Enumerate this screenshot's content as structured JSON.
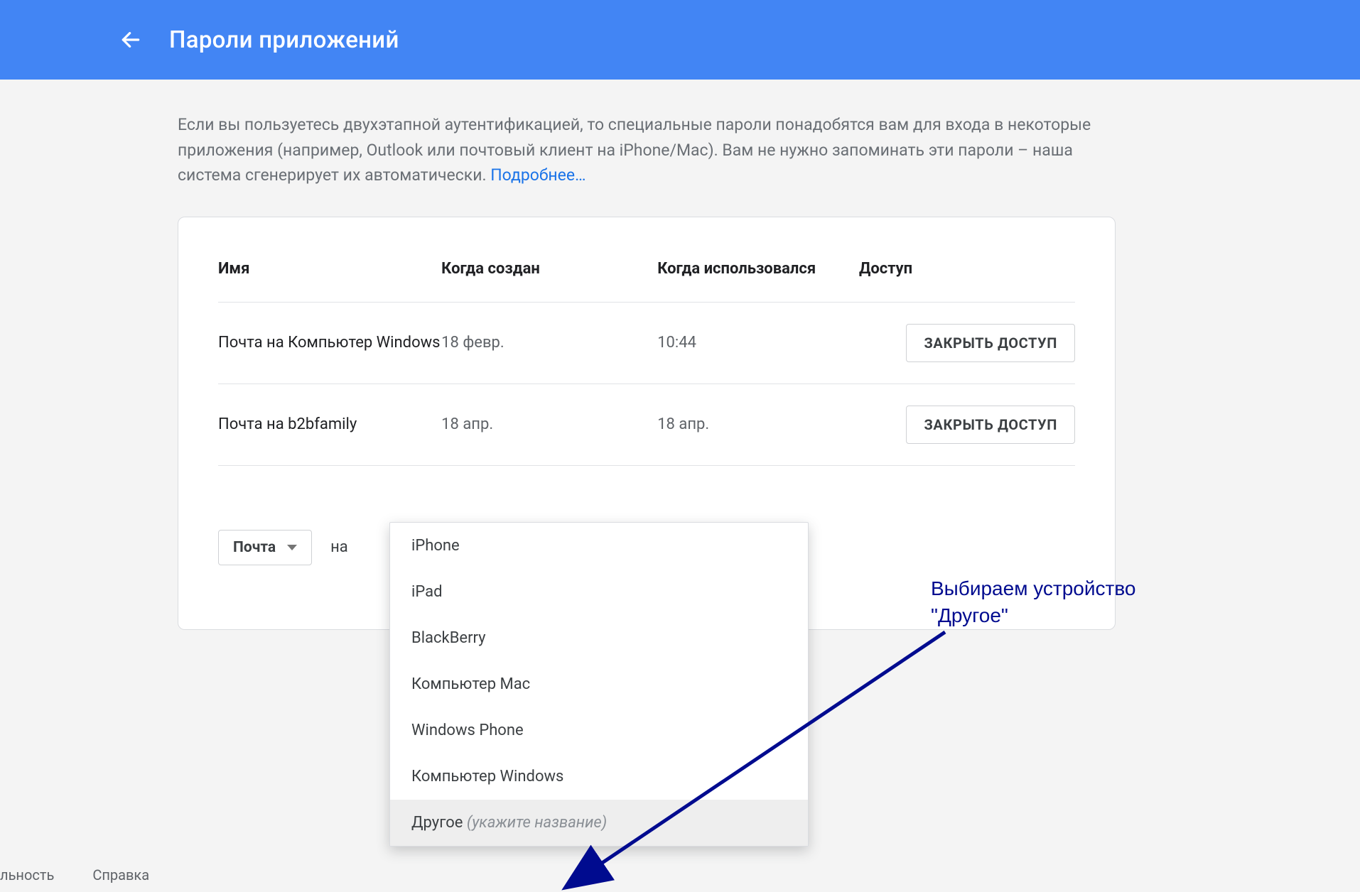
{
  "header": {
    "title": "Пароли приложений"
  },
  "intro": {
    "text": "Если вы пользуетесь двухэтапной аутентификацией, то специальные пароли понадобятся вам для входа в некоторые приложения (например, Outlook или почтовый клиент на iPhone/Mac). Вам не нужно запоминать эти пароли – наша система сгенерирует их автоматически. ",
    "learn_more": "Подробнее…"
  },
  "table": {
    "headers": {
      "name": "Имя",
      "created": "Когда создан",
      "used": "Когда использовался",
      "access": "Доступ"
    },
    "revoke_label": "ЗАКРЫТЬ ДОСТУП",
    "rows": [
      {
        "name": "Почта на Компьютер Windows",
        "created": "18 февр.",
        "used": "10:44"
      },
      {
        "name": "Почта на b2bfamily",
        "created": "18 апр.",
        "used": "18 апр."
      }
    ]
  },
  "selector": {
    "app_label": "Почта",
    "conjunction": "на"
  },
  "device_menu": {
    "options": [
      {
        "label": "iPhone"
      },
      {
        "label": "iPad"
      },
      {
        "label": "BlackBerry"
      },
      {
        "label": "Компьютер Mac"
      },
      {
        "label": "Windows Phone"
      },
      {
        "label": "Компьютер Windows"
      },
      {
        "label": "Другое ",
        "hint": "(укажите название)",
        "highlight": true
      }
    ]
  },
  "annotation": {
    "line1": "Выбираем устройство",
    "line2": "\"Другое\""
  },
  "footer": {
    "link1": "льность",
    "link2": "Справка"
  }
}
